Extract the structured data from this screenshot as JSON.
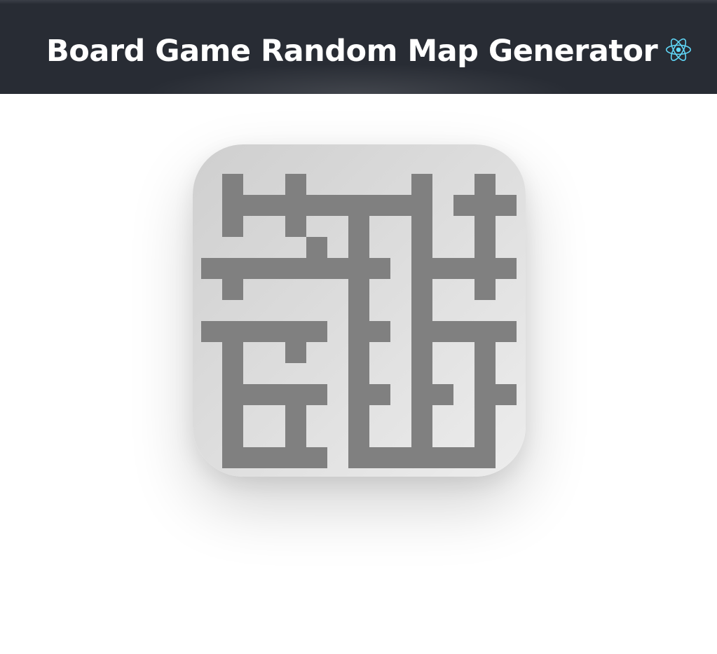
{
  "header": {
    "title": "Board Game Random Map Generator",
    "logo_icon": "react-atom-icon",
    "background_color": "#282c34",
    "logo_color": "#61dafb"
  },
  "map": {
    "columns": 15,
    "rows": 15,
    "wall_color": "#808080",
    "floor_gradient": [
      "#cfcfcf",
      "#ededed"
    ],
    "grid": [
      "...............",
      ".#..#.....#..#.",
      ".##########.###",
      ".#..#..#..#..#.",
      ".....#.#..#..#.",
      "#########.#####",
      ".#.....#..#..#.",
      ".......#..#....",
      "######.##.#####",
      ".#..#..#..#..#.",
      ".#.....#..#..#.",
      ".#####.##.##.##",
      ".#..#..#..#..#.",
      ".#..#..#..#..#.",
      ".#####.#######."
    ]
  }
}
